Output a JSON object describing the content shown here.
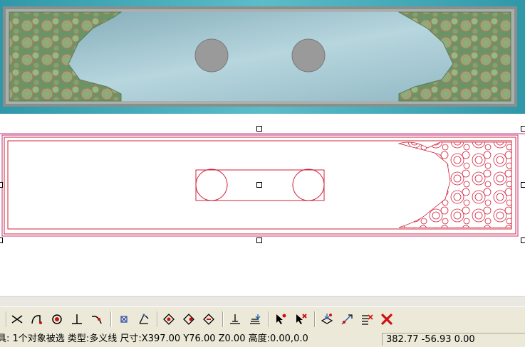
{
  "status": {
    "main_text": "具: 1个对象被选 类型:多义线 尺寸:X397.00 Y76.00 Z0.00 高度:0.00,0.0",
    "coords": "382.77 -56.93 0.00"
  },
  "toolbar": {
    "buttons": [
      "snap-intersection-icon",
      "snap-tangent-arc-icon",
      "snap-circle-icon",
      "snap-perpendicular-icon",
      "snap-nearest-curve-icon",
      "snap-grid-point-icon",
      "snap-angle-icon",
      "diamond-op-1-icon",
      "diamond-op-2-icon",
      "diamond-op-3-icon",
      "align-bottom-icon",
      "align-stack-icon",
      "node-select-icon",
      "node-delete-icon",
      "layer-transform-icon",
      "path-edit-icon",
      "list-edit-icon",
      "delete-icon"
    ]
  },
  "colors": {
    "background_teal": "#3fa9b6",
    "carving_green": "#6f9c6a",
    "panel_blue": "#9dc3cf",
    "hole_gray": "#9a9a9a",
    "vector_red": "#d0203a",
    "border_magenta": "#c0307a",
    "delete_red": "#d01010"
  }
}
